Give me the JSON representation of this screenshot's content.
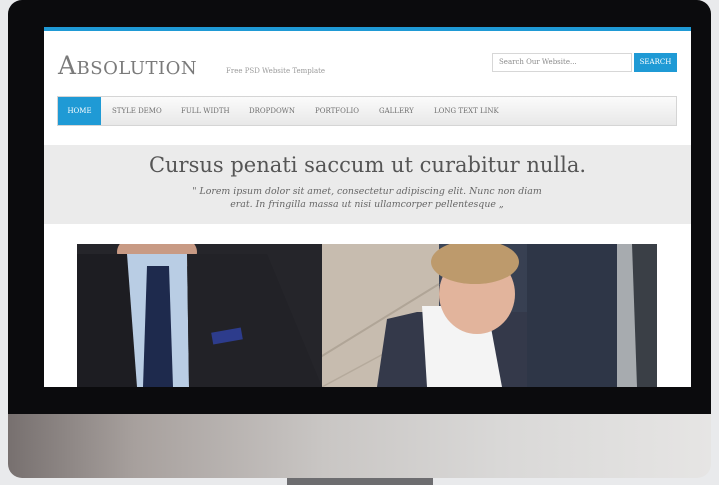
{
  "site": {
    "logo": "Absolution",
    "tagline": "Free PSD Website Template"
  },
  "search": {
    "placeholder": "Search Our Website...",
    "button_label": "SEARCH"
  },
  "nav": {
    "items": [
      {
        "label": "HOME",
        "active": true
      },
      {
        "label": "STYLE DEMO"
      },
      {
        "label": "FULL WIDTH"
      },
      {
        "label": "DROPDOWN"
      },
      {
        "label": "PORTFOLIO"
      },
      {
        "label": "GALLERY"
      },
      {
        "label": "LONG TEXT LINK"
      }
    ]
  },
  "hero": {
    "title": "Cursus penati saccum ut curabitur nulla.",
    "quote_line1": "\" Lorem ipsum dolor sit amet, consectetur adipiscing elit. Nunc non diam",
    "quote_line2": "erat. In fringilla massa ut nisi ullamcorper pellentesque „"
  },
  "colors": {
    "accent": "#1f9ad5",
    "bezel": "#0b0b0d",
    "hero_band": "#ebebeb"
  }
}
